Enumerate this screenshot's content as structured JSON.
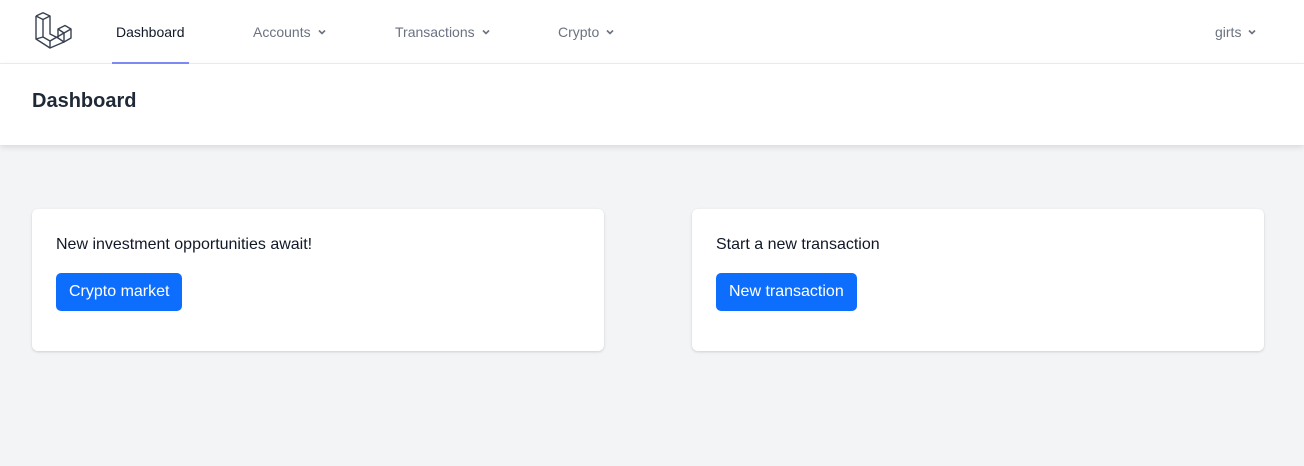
{
  "nav": {
    "logo_icon": "laravel-logo-icon",
    "items": [
      {
        "label": "Dashboard",
        "active": true
      },
      {
        "label": "Accounts",
        "dropdown": true
      },
      {
        "label": "Transactions",
        "dropdown": true
      },
      {
        "label": "Crypto",
        "dropdown": true
      }
    ],
    "user": {
      "label": "girts",
      "dropdown": true
    },
    "active_underline_color": "#818cf8"
  },
  "header": {
    "title": "Dashboard"
  },
  "cards": [
    {
      "text": "New investment opportunities await!",
      "button_label": "Crypto market"
    },
    {
      "text": "Start a new transaction",
      "button_label": "New transaction"
    }
  ],
  "colors": {
    "primary_button": "#0d6efd",
    "page_background": "#f3f4f6"
  }
}
